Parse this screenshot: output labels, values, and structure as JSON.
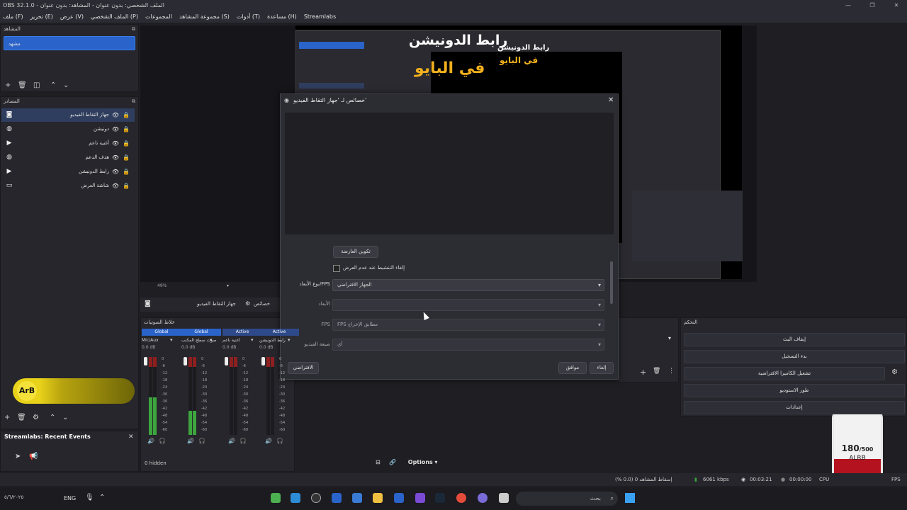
{
  "window": {
    "title": "OBS 32.1.0 - الملف الشخصي: بدون عنوان - المشاهد: بدون عنوان",
    "min": "—",
    "max": "❐",
    "close": "✕"
  },
  "menu": [
    "ملف (F)",
    "تحرير (E)",
    "عرض (V)",
    "الملف الشخصي (P)",
    "المجموعات",
    "مجموعة المشاهد (S)",
    "أدوات (T)",
    "مساعدة (H)",
    "Streamlabs"
  ],
  "scenes": {
    "title": "المشاهد",
    "items": [
      "مشهد"
    ]
  },
  "sources": {
    "title": "المصادر",
    "items": [
      {
        "name": "جهاز التقاط الفيديو",
        "icon": "camera-icon",
        "glyph": "◙"
      },
      {
        "name": "دونيشن",
        "icon": "browser-icon",
        "glyph": "◍"
      },
      {
        "name": "أغنية ناعم",
        "icon": "media-icon",
        "glyph": "▶"
      },
      {
        "name": "هدف الدعم",
        "icon": "browser-icon",
        "glyph": "◍"
      },
      {
        "name": "رابط الدونيشن",
        "icon": "media-icon",
        "glyph": "▶"
      },
      {
        "name": "شاشة العرض",
        "icon": "display-icon",
        "glyph": "▭"
      }
    ]
  },
  "preview": {
    "banner_line1": "رابط الدونيشن",
    "banner_line2": "في البايو",
    "small_line1": "رابط الدونيشن",
    "small_line2": "في البايو",
    "zoom": "49%"
  },
  "dialog": {
    "title": "خصائص لـ 'جهاز التقاط الفيديو'",
    "configure_crossbar": "تكوين العارضة",
    "deactivate_checkbox": "إلغاء التنشيط عند عدم العرض",
    "fields": [
      {
        "label": "نوع الأبعاد/FPS",
        "value": "الجهاز الافتراضي"
      },
      {
        "label": "الأبعاد",
        "value": ""
      },
      {
        "label": "FPS",
        "value": "FPS مطابق الإخراج"
      },
      {
        "label": "صيغة الفيديو",
        "value": "أي"
      }
    ],
    "defaults_button": "الافتراضي",
    "ok_button": "موافق",
    "cancel_button": "إلغاء"
  },
  "source_toolbar": {
    "source_name": "جهاز التقاط الفيديو",
    "properties": "خصائص"
  },
  "mixer": {
    "title": "خلاط الصوتيات",
    "channels": [
      {
        "badge": "Global",
        "name": "Mic/Aux",
        "db": "0.0 dB",
        "level": 0.55
      },
      {
        "badge": "Global",
        "name": "صوت سطح المكتب",
        "db": "0.0 dB",
        "level": 0.35
      },
      {
        "badge": "Active",
        "name": "أغنية ناعم",
        "db": "0.0 dB",
        "level": 0.0
      },
      {
        "badge": "Active",
        "name": "رابط الدونيشن",
        "db": "0.0 dB",
        "level": 0.0
      }
    ],
    "scale": [
      "0",
      "-6",
      "-12",
      "-18",
      "-24",
      "-30",
      "-36",
      "-42",
      "-48",
      "-54",
      "-60"
    ],
    "hidden": "0 hidden",
    "options": "Options"
  },
  "controls": {
    "title": "التحكم",
    "buttons": [
      "إيقاف البث",
      "بدء التسجيل",
      "تشغيل الكاميرا الافتراضية",
      "طور الاستوديو",
      "إعدادات"
    ]
  },
  "recent_events": {
    "title": "Streamlabs: Recent Events"
  },
  "arb_logo": "ArB",
  "status": {
    "dropped": "إسقاط المشاهد 0 (0.0 %)",
    "bitrate": "6061 kbps",
    "live_time": "00:03:21",
    "rec_time": "00:00:00",
    "cpu": "CPU",
    "fps": "FPS"
  },
  "donation_goal": {
    "current": "180",
    "goal": "/500",
    "label": "ALRB"
  },
  "taskbar": {
    "lang": "ENG",
    "search": "بحث",
    "clock": "٥/٦/٢٠٢٥"
  },
  "colors": {
    "accent": "#2a63c9",
    "meter_green": "#3da53d",
    "meter_red": "#8e1f1f"
  }
}
